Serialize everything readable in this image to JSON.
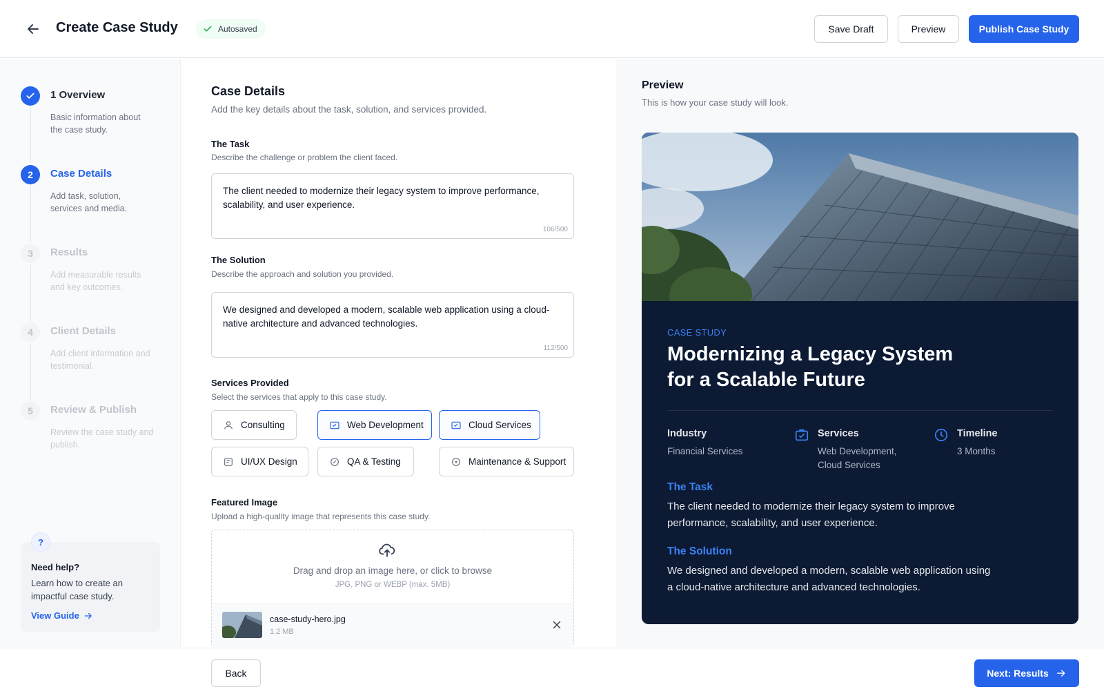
{
  "header": {
    "title": "Create Case Study",
    "autosave_label": "Autosaved",
    "save_draft_label": "Save Draft",
    "preview_label": "Preview",
    "publish_label": "Publish Case Study"
  },
  "steps": [
    {
      "number": "1",
      "title": "1 Overview",
      "desc": "Basic information about the case study.",
      "state": "done"
    },
    {
      "number": "2",
      "title": "Case Details",
      "desc": "Add task, solution, services and media.",
      "state": "active"
    },
    {
      "number": "3",
      "title": "Results",
      "desc": "Add measurable results and key outcomes.",
      "state": "todo"
    },
    {
      "number": "4",
      "title": "Client Details",
      "desc": "Add client information and testimonial.",
      "state": "todo"
    },
    {
      "number": "5",
      "title": "Review & Publish",
      "desc": "Review the case study and publish.",
      "state": "todo"
    }
  ],
  "help": {
    "icon": "?",
    "title": "Need help?",
    "text": "Learn how to create an impactful case study.",
    "link": "View Guide"
  },
  "form": {
    "title": "Case Details",
    "subtitle": "Add the key details about the task, solution, and services provided.",
    "task": {
      "label": "The Task",
      "help": "Describe the challenge or problem the client faced.",
      "value": "The client needed to modernize their legacy system to improve performance, scalability, and user experience.",
      "counter": "106/500"
    },
    "solution": {
      "label": "The Solution",
      "help": "Describe the approach and solution you provided.",
      "value": "We designed and developed a modern, scalable web application using a cloud-native architecture and advanced technologies.",
      "counter": "112/500"
    },
    "services": {
      "label": "Services Provided",
      "help": "Select the services that apply to this case study.",
      "options": [
        {
          "label": "Consulting",
          "selected": false,
          "icon": "consulting-icon"
        },
        {
          "label": "Web Development",
          "selected": true,
          "icon": "web-development-icon"
        },
        {
          "label": "Cloud Services",
          "selected": true,
          "icon": "cloud-services-icon"
        },
        {
          "label": "UI/UX Design",
          "selected": false,
          "icon": "design-icon"
        },
        {
          "label": "QA & Testing",
          "selected": false,
          "icon": "testing-icon"
        },
        {
          "label": "Maintenance & Support",
          "selected": false,
          "icon": "support-icon"
        }
      ]
    },
    "image": {
      "label": "Featured Image",
      "help": "Upload a high-quality image that represents this case study.",
      "drop_text": "Drag and drop an image here, or click to browse",
      "hint": "JPG, PNG or WEBP (max. 5MB)",
      "file_name": "case-study-hero.jpg",
      "file_size": "1.2 MB"
    }
  },
  "preview": {
    "title": "Preview",
    "subtitle": "This is how your case study will look.",
    "kicker": "CASE STUDY",
    "case_title": "Modernizing a Legacy System for a Scalable Future",
    "industry_label": "Industry",
    "industry_value": "Financial Services",
    "services_label": "Services",
    "services_value": "Web Development, Cloud Services",
    "timeline_label": "Timeline",
    "timeline_value": "3 Months",
    "task_heading": "The Task",
    "task_text": "The client needed to modernize their legacy system to improve performance, scalability, and user experience.",
    "solution_heading": "The Solution",
    "solution_text": "We designed and developed a modern, scalable web application using a cloud-native architecture and advanced technologies."
  },
  "footer": {
    "back_label": "Back",
    "next_label": "Next: Results"
  },
  "colors": {
    "primary": "#2563eb",
    "card_background": "#0c1a33",
    "accent_text": "#3b82f6"
  }
}
